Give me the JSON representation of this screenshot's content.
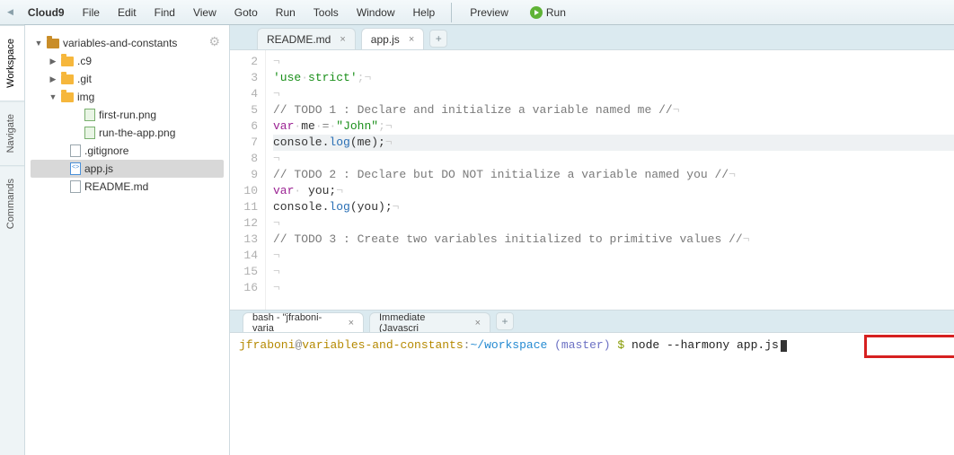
{
  "menubar": {
    "brand": "Cloud9",
    "items": [
      "File",
      "Edit",
      "Find",
      "View",
      "Goto",
      "Run",
      "Tools",
      "Window",
      "Help"
    ],
    "preview": "Preview",
    "run": "Run"
  },
  "side_tabs": [
    "Workspace",
    "Navigate",
    "Commands"
  ],
  "tree": {
    "root": "variables-and-constants",
    "c9": ".c9",
    "git": ".git",
    "img": "img",
    "first_run": "first-run.png",
    "run_the_app": "run-the-app.png",
    "gitignore": ".gitignore",
    "appjs": "app.js",
    "readme": "README.md"
  },
  "editor_tabs": {
    "readme": "README.md",
    "appjs": "app.js"
  },
  "code": {
    "line_start": 2,
    "line_end": 16,
    "l2": "¬",
    "l3_a": "'use",
    "l3_b": "strict'",
    "l3_c": ";¬",
    "l4": "¬",
    "l5": "// TODO 1 : Declare and initialize a variable named me //",
    "l5_end": "¬",
    "l6_kw": "var",
    "l6_id": "me",
    "l6_eq": " = ",
    "l6_str": "\"John\"",
    "l6_end": ";¬",
    "l7_a": "console.",
    "l7_fn": "log",
    "l7_b": "(me);",
    "l7_end": "¬",
    "l8": "¬",
    "l9": "// TODO 2 : Declare but DO NOT initialize a variable named you //",
    "l9_end": "¬",
    "l10_kw": "var",
    "l10_id": " you;",
    "l10_end": "¬",
    "l11_a": "console.",
    "l11_fn": "log",
    "l11_b": "(you);",
    "l11_end": "¬",
    "l12": "¬",
    "l13": "// TODO 3 : Create two variables initialized to primitive values //",
    "l13_end": "¬",
    "l14": "¬",
    "l15": "¬",
    "l16": "¬"
  },
  "term_tabs": {
    "bash": "bash - \"jfraboni-varia",
    "immediate": "Immediate (Javascri"
  },
  "terminal": {
    "user": "jfraboni",
    "at": "@",
    "host": "variables-and-constants",
    "colon": ":",
    "path": "~/workspace",
    "branch_open": " (",
    "branch": "master",
    "branch_close": ") ",
    "dollar": "$",
    "space": " ",
    "cmd": "node --harmony app.js"
  }
}
